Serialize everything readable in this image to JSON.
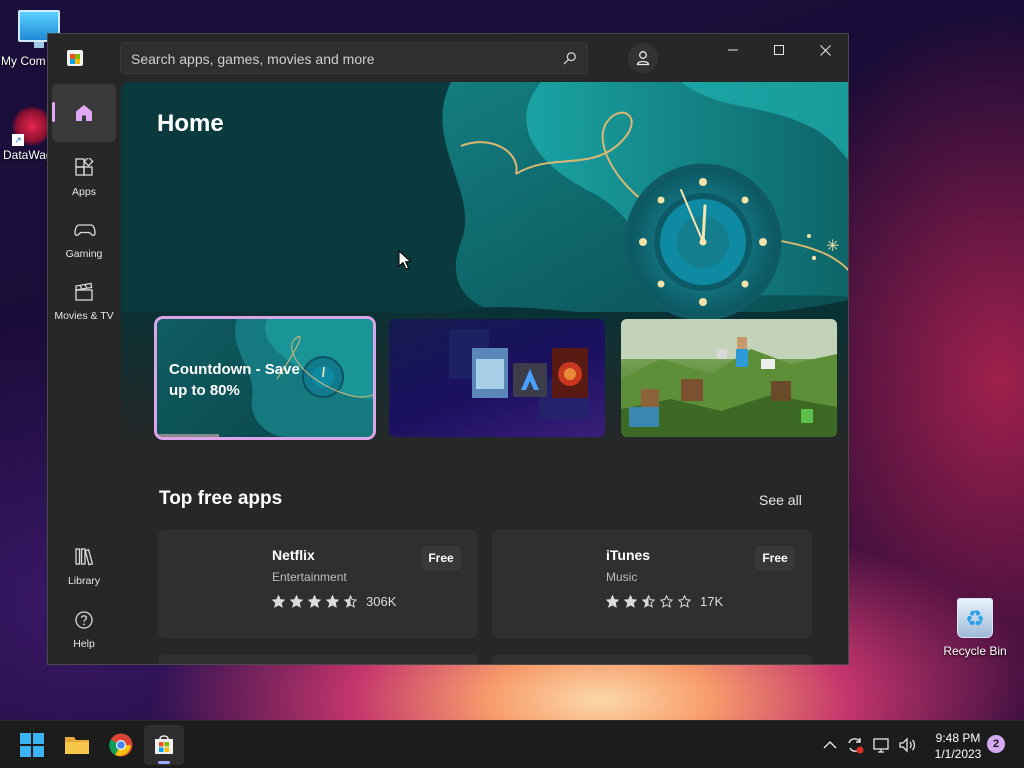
{
  "desktop": {
    "icons": [
      {
        "label": "My Com"
      },
      {
        "label": "DataWag"
      },
      {
        "label": "Recycle Bin"
      }
    ]
  },
  "store": {
    "search": {
      "placeholder": "Search apps, games, movies and more"
    },
    "nav": [
      {
        "label": "",
        "icon": "home-icon"
      },
      {
        "label": "Apps",
        "icon": "apps-icon"
      },
      {
        "label": "Gaming",
        "icon": "gaming-icon"
      },
      {
        "label": "Movies & TV",
        "icon": "movies-tv-icon"
      },
      {
        "label": "Library",
        "icon": "library-icon"
      },
      {
        "label": "Help",
        "icon": "help-icon"
      }
    ],
    "hero": {
      "title": "Home",
      "cards": [
        {
          "title": "Countdown - Save up to 80%"
        },
        {
          "title": ""
        },
        {
          "title": ""
        }
      ]
    },
    "section": {
      "title": "Top free apps",
      "see_all": "See all"
    },
    "apps": [
      {
        "name": "Netflix",
        "category": "Entertainment",
        "rating": 4.5,
        "rating_count": "306K",
        "price": "Free"
      },
      {
        "name": "iTunes",
        "category": "Music",
        "rating": 2.5,
        "rating_count": "17K",
        "price": "Free"
      }
    ],
    "colors": {
      "accent": "#e2a8f6",
      "background": "#272727",
      "tile": "#2f2f2f"
    }
  },
  "taskbar": {
    "apps": [
      "start-icon",
      "file-explorer-icon",
      "chrome-icon",
      "store-icon"
    ],
    "clock": {
      "time": "9:48 PM",
      "date": "1/1/2023"
    },
    "notifications": "2"
  }
}
